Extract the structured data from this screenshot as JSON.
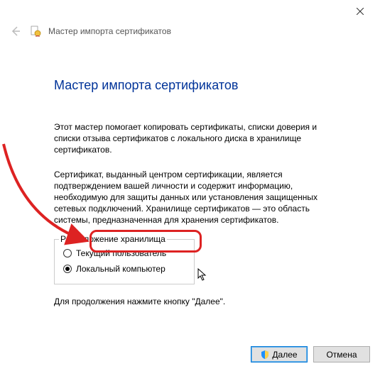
{
  "window": {
    "title": "Мастер импорта сертификатов"
  },
  "heading": "Мастер импорта сертификатов",
  "intro": "Этот мастер помогает копировать сертификаты, списки доверия и списки отзыва сертификатов с локального диска в хранилище сертификатов.",
  "description": "Сертификат, выданный центром сертификации, является подтверждением вашей личности и содержит информацию, необходимую для защиты данных или установления защищенных сетевых подключений. Хранилище сертификатов — это область системы, предназначенная для хранения сертификатов.",
  "storage": {
    "legend": "Расположение хранилища",
    "current_user": "Текущий пользователь",
    "local_machine": "Локальный компьютер",
    "selected": "local_machine"
  },
  "continue_hint": "Для продолжения нажмите кнопку \"Далее\".",
  "buttons": {
    "next": "Далее",
    "cancel": "Отмена"
  }
}
